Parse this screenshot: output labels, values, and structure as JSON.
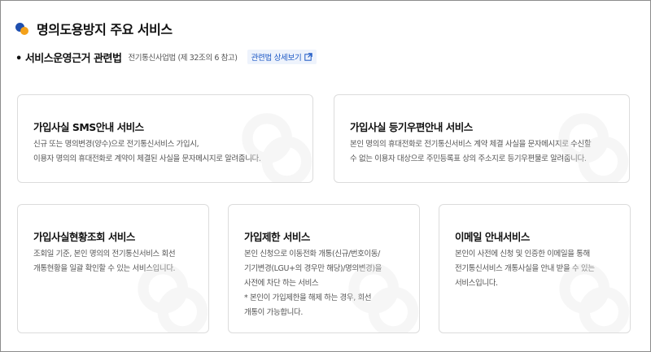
{
  "page": {
    "title": "명의도용방지 주요 서비스"
  },
  "law": {
    "label": "• 서비스운영근거 관련법",
    "note": "전기통신사업법 (제 32조의 6 참고)",
    "link_label": "관련법 상세보기",
    "link_icon": "external-link-icon"
  },
  "colors": {
    "dot_blue": "#1f4fae",
    "dot_orange": "#f4a11a",
    "link": "#1a56c4"
  },
  "services": [
    {
      "title": "가입사실 SMS안내 서비스",
      "desc": "신규 또는 명의변경(양수)으로 전기통신서비스 가입시,\n이용자 명의의 휴대전화로 계약이 체결된 사실을 문자메시지로 알려줍니다."
    },
    {
      "title": "가입사실 등기우편안내 서비스",
      "desc": "본인 명의의 휴대전화로 전기통신서비스 계약 체결 사실을 문자메시지로 수신할\n수 없는 이용자 대상으로 주민등록표 상의 주소지로 등기우편물로 알려줍니다."
    },
    {
      "title": "가입사실현황조회 서비스",
      "desc": "조회일 기준, 본인 명의의 전기통신서비스 회선\n개통현황을 일괄 확인할 수 있는 서비스입니다."
    },
    {
      "title": "가입제한 서비스",
      "desc": "본인 신청으로 이동전화 개통(신규/번호이동/\n기기변경(LGU+의 경우만 해당)/명의변경)을\n사전에 차단 하는 서비스\n* 본인이 가입제한을 해제 하는 경우, 회선\n개통이 가능합니다."
    },
    {
      "title": "이메일 안내서비스",
      "desc": "본인이 사전에 신청 및 인증한 이메일을 통해\n전기통신서비스 개통사실을 안내 받을 수 있는\n서비스입니다."
    }
  ]
}
